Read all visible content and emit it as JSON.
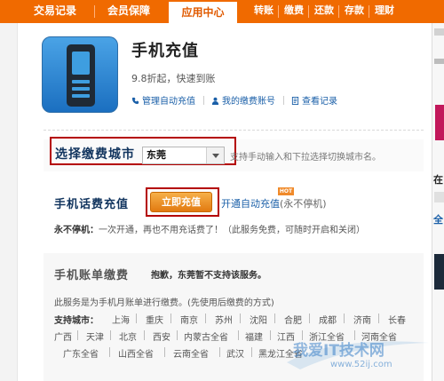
{
  "nav": {
    "tabs": [
      "交易记录",
      "会员保障",
      "应用中心"
    ],
    "subtabs": [
      "转账",
      "缴费",
      "还款",
      "存款",
      "理财"
    ]
  },
  "app": {
    "title": "手机充值",
    "subtitle": "9.8折起，快速到账",
    "links": [
      "管理自动充值",
      "我的缴费账号",
      "查看记录"
    ]
  },
  "city": {
    "label": "选择缴费城市",
    "value": "东莞",
    "hint": "支持手动输入和下拉选择切换城市名。"
  },
  "recharge": {
    "title": "手机话费充值",
    "button": "立即充值",
    "hot": "HOT",
    "auto_link": "开通自动充值",
    "auto_paren": "(永不停机)",
    "nostop_label": "永不停机：",
    "nostop_text": "一次开通，再也不用充话费了！（此服务免费，可随时开启和关闭）"
  },
  "bill": {
    "title": "手机账单缴费",
    "note": "抱歉，东莞暂不支持该服务。",
    "desc": "此服务是为手机月账单进行缴费。(先使用后缴费的方式)",
    "cities_label": "支持城市：",
    "cities_rows": [
      [
        "上海",
        "重庆",
        "南京",
        "苏州",
        "沈阳",
        "合肥",
        "成都",
        "济南",
        "长春"
      ],
      [
        "广西",
        "天津",
        "北京",
        "西安",
        "内蒙古全省",
        "福建",
        "江西",
        "浙江全省",
        "河南全省"
      ],
      [
        "广东全省",
        "山西全省",
        "云南全省",
        "武汉",
        "黑龙江全省"
      ]
    ]
  },
  "watermark": {
    "text": "我爱IT技术网",
    "url": "www.52ij.com"
  },
  "right": {
    "chars": [
      "在",
      "全"
    ]
  }
}
